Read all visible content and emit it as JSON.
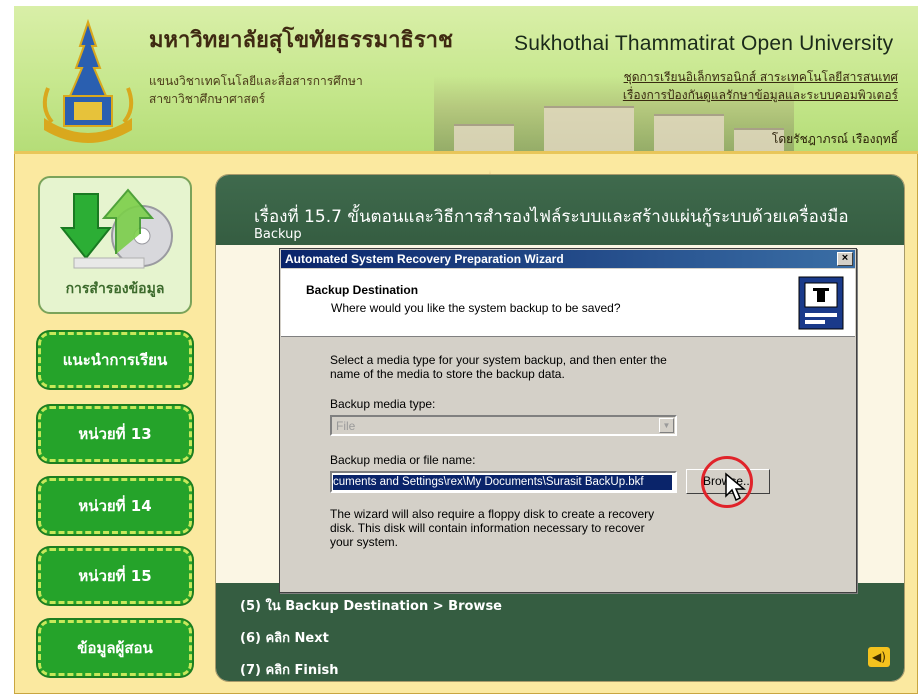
{
  "header": {
    "uni_thai": "มหาวิทยาลัยสุโขทัยธรรมาธิราช",
    "uni_en": "Sukhothai Thammatirat Open University",
    "dept_line1": "แขนงวิชาเทคโนโลยีและสื่อสารการศึกษา",
    "dept_line2": "สาขาวิชาศึกษาศาสตร์",
    "series_line1": "ชุดการเรียนอิเล็กทรอนิกส์ สาระเทคโนโลยีสารสนเทศ",
    "series_line2": "เรื่องการป้องกันดูแลรักษาข้อมูลและระบบคอมพิวเตอร์",
    "author": "โดยรัชฎาภรณ์ เรืองฤทธิ์"
  },
  "sidebar": {
    "top_label": "การสำรองข้อมูล",
    "items": [
      {
        "label": "แนะนำการเรียน"
      },
      {
        "label": "หน่วยที่ 13"
      },
      {
        "label": "หน่วยที่ 14"
      },
      {
        "label": "หน่วยที่ 15"
      },
      {
        "label": "ข้อมูลผู้สอน"
      }
    ]
  },
  "content": {
    "title_line1": "เรื่องที่ 15.7 ขั้นตอนและวิธีการสำรองไฟล์ระบบและสร้างแผ่นกู้ระบบด้วยเครื่องมือ",
    "title_line2": "Backup",
    "steps": [
      "(5) ใน Backup Destination > Browse",
      "(6) คลิก Next",
      "(7) คลิก Finish"
    ]
  },
  "dialog": {
    "title": "Automated System Recovery Preparation Wizard",
    "close": "×",
    "heading": "Backup Destination",
    "subheading": "Where would you like the system backup to be saved?",
    "instruction_line1": "Select a media type for your system backup, and then enter the",
    "instruction_line2": "name of the media to store the backup data.",
    "media_type_label": "Backup media type:",
    "media_type_value": "File",
    "file_name_label": "Backup media or file name:",
    "file_name_value": "cuments and Settings\\rex\\My Documents\\Surasit BackUp.bkf",
    "browse_label": "Browse...",
    "note_line1": "The wizard will also require a floppy disk to create a recovery",
    "note_line2": "disk. This disk will contain information necessary to recover",
    "note_line3": "your system."
  },
  "colors": {
    "header_green": "#c6e78d",
    "panel_dark_green": "#355d41",
    "nav_green": "#25a32a",
    "frame_yellow": "#fbe9a0",
    "dialog_title_blue": "#0a246a",
    "highlight_red": "#e0232a"
  }
}
